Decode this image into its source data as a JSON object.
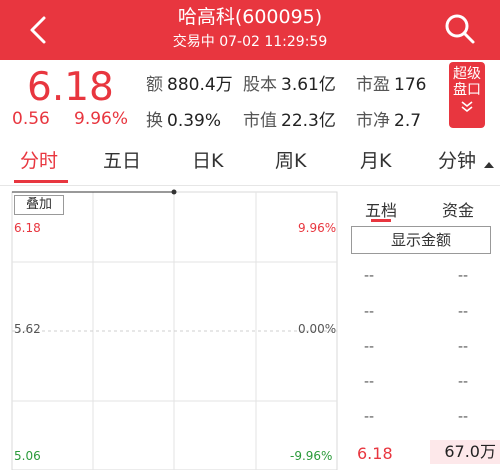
{
  "header": {
    "title": "哈高科(600095)",
    "subtitle": "交易中 07-02 11:29:59"
  },
  "quote": {
    "price": "6.18",
    "change": "0.56",
    "change_pct": "9.96%",
    "stats": [
      {
        "label": "额",
        "value": "880.4万"
      },
      {
        "label": "股本",
        "value": "3.61亿"
      },
      {
        "label": "市盈",
        "value": "176"
      },
      {
        "label": "换",
        "value": "0.39%"
      },
      {
        "label": "市值",
        "value": "22.3亿"
      },
      {
        "label": "市净",
        "value": "2.7"
      }
    ],
    "super_button": "超级盘口"
  },
  "tabs": [
    "分时",
    "五日",
    "日K",
    "周K",
    "月K",
    "分钟"
  ],
  "chart": {
    "overlay_label": "叠加",
    "y_left": [
      "6.18",
      "5.62",
      "5.06"
    ],
    "y_right": [
      "9.96%",
      "0.00%",
      "-9.96%"
    ]
  },
  "right_panel": {
    "tabs": [
      "五档",
      "资金"
    ],
    "show_amount": "显示金额",
    "dash": "--",
    "last_price": "6.18",
    "last_amount": "67.0万"
  },
  "colors": {
    "accent": "#e8363f",
    "up": "#e8363f",
    "down": "#2a9a3a"
  }
}
